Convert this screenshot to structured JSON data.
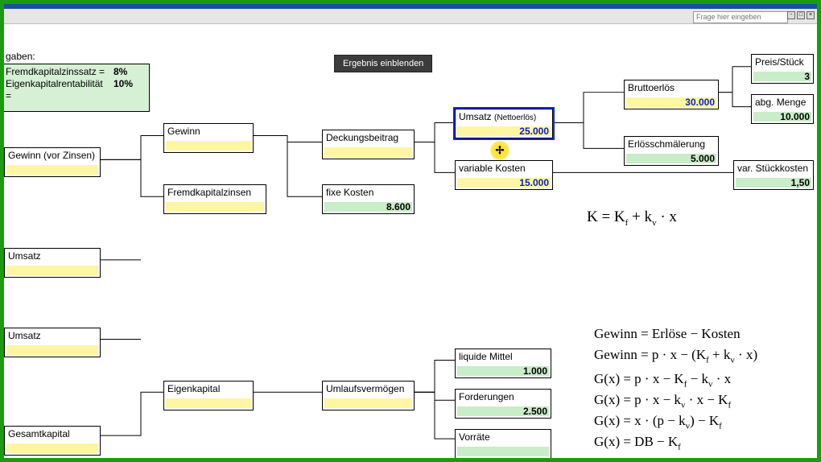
{
  "app": {
    "question_placeholder": "Frage hier eingeben"
  },
  "inputs": {
    "heading": "gaben:",
    "row1_label": "Fremdkapitalzinssatz =",
    "row1_value": "8%",
    "row2_label": "Eigenkapitalrentabilität =",
    "row2_value": "10%"
  },
  "button": {
    "ergebnis": "Ergebnis einblenden"
  },
  "nodes": {
    "gewinn_vor_zinsen": {
      "title": "Gewinn (vor Zinsen)",
      "value": ""
    },
    "gewinn": {
      "title": "Gewinn",
      "value": ""
    },
    "fremdkapitalzinsen": {
      "title": "Fremdkapitalzinsen",
      "value": ""
    },
    "deckungsbeitrag": {
      "title": "Deckungsbeitrag",
      "value": ""
    },
    "fixe_kosten": {
      "title": "fixe Kosten",
      "value": "8.600"
    },
    "umsatz": {
      "title": "Umsatz",
      "sub": "(Nettoerlös)",
      "value": "25.000"
    },
    "variable_kosten": {
      "title": "variable Kosten",
      "value": "15.000"
    },
    "bruttoerloes": {
      "title": "Bruttoerlös",
      "value": "30.000"
    },
    "erloesschmaelerung": {
      "title": "Erlösschmälerung",
      "value": "5.000"
    },
    "preis_stueck": {
      "title": "Preis/Stück",
      "value": "3"
    },
    "abg_menge": {
      "title": "abg. Menge",
      "value": "10.000"
    },
    "var_stueckkosten": {
      "title": "var. Stückkosten",
      "value": "1,50"
    },
    "umsatz2": {
      "title": "Umsatz",
      "value": ""
    },
    "umsatz3": {
      "title": "Umsatz",
      "value": ""
    },
    "gesamtkapital": {
      "title": "Gesamtkapital",
      "value": ""
    },
    "eigenkapital": {
      "title": "Eigenkapital",
      "value": ""
    },
    "umlaufvermoegen": {
      "title": "Umlaufsvermögen",
      "value": ""
    },
    "liquide_mittel": {
      "title": "liquide Mittel",
      "value": "1.000"
    },
    "forderungen": {
      "title": "Forderungen",
      "value": "2.500"
    },
    "vorraete": {
      "title": "Vorräte",
      "value": ""
    }
  },
  "formulas": {
    "f1": "K = K_f + k_v · x",
    "f2": "Gewinn = Erlöse − Kosten",
    "f3": "Gewinn = p · x − (K_f + k_v · x)",
    "f4": "G(x) = p · x − K_f − k_v · x",
    "f5": "G(x) = p · x − k_v · x − K_f",
    "f6": "G(x) = x · (p − k_v) − K_f",
    "f7": "G(x) = DB − K_f"
  }
}
